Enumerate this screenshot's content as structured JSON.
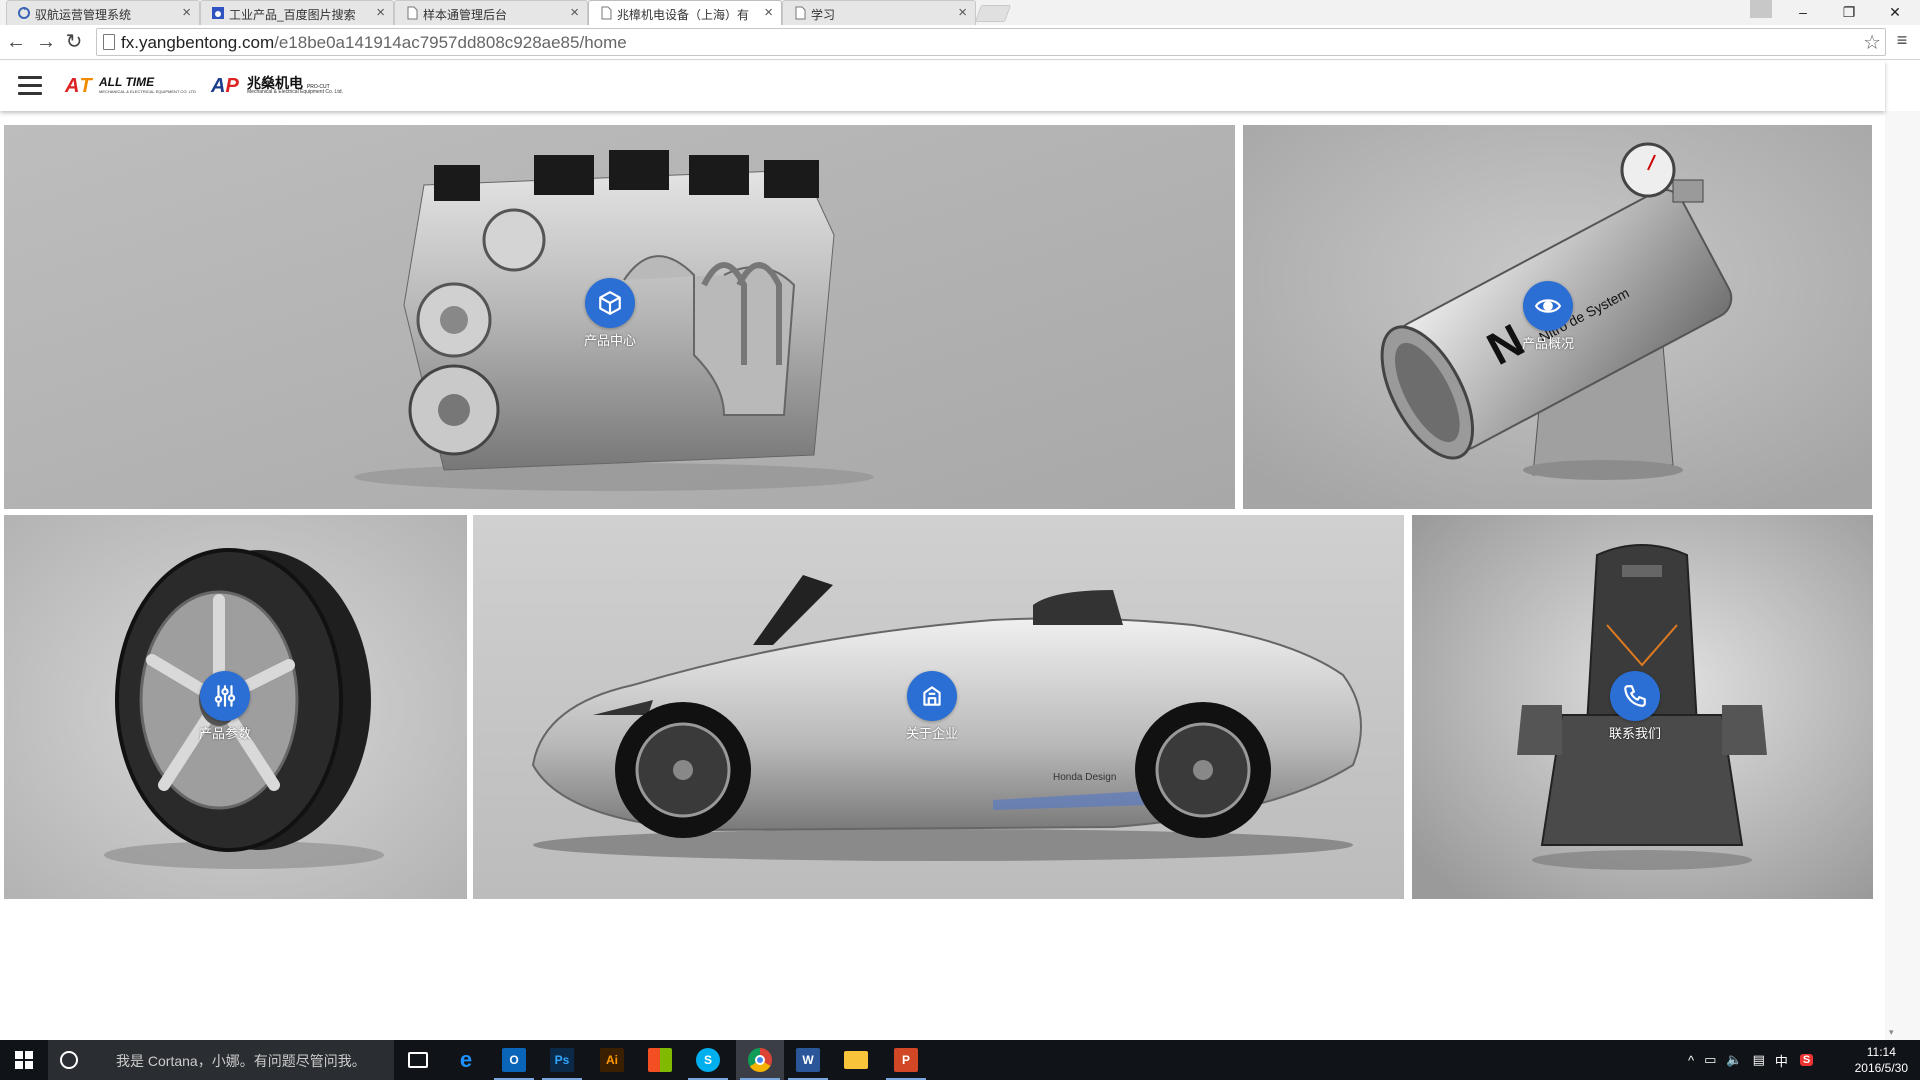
{
  "browser": {
    "tabs": [
      {
        "title": "驭航运营管理系统",
        "active": false
      },
      {
        "title": "工业产品_百度图片搜索",
        "active": false
      },
      {
        "title": "样本通管理后台",
        "active": false
      },
      {
        "title": "兆樟机电设备（上海）有",
        "active": true
      },
      {
        "title": "学习",
        "active": false
      }
    ],
    "url_host": "fx.yangbentong.com",
    "url_path": "/e18be0a141914ac7957dd808c928ae85/home"
  },
  "site": {
    "logo1_name": "ALL TIME",
    "logo1_sub": "MECHANICAL & ELECTRICAL EQUIPMENT CO. LTD",
    "logo2_name": "兆燊机电",
    "logo2_tag": "PRO-CUT",
    "logo2_sub": "Mechanical & Electrical Equipment Co. Ltd."
  },
  "tiles": [
    {
      "label": "产品中心",
      "icon": "cube-icon"
    },
    {
      "label": "产品概况",
      "icon": "eye-icon"
    },
    {
      "label": "产品参数",
      "icon": "sliders-icon"
    },
    {
      "label": "关于企业",
      "icon": "building-icon"
    },
    {
      "label": "联系我们",
      "icon": "phone-icon"
    }
  ],
  "tile_art_text": {
    "canister": "Nitro  de System",
    "car_badge": "Honda Design"
  },
  "colors": {
    "accent": "#2b6ed4",
    "taskbar": "#101418"
  },
  "taskbar": {
    "cortana_placeholder": "我是 Cortana，小娜。有问题尽管问我。",
    "apps": [
      "task-view",
      "edge",
      "outlook",
      "photoshop",
      "illustrator",
      "store",
      "skype",
      "chrome",
      "word",
      "file-explorer",
      "powerpoint"
    ],
    "ime": "中",
    "time": "11:14",
    "date": "2016/5/30"
  }
}
